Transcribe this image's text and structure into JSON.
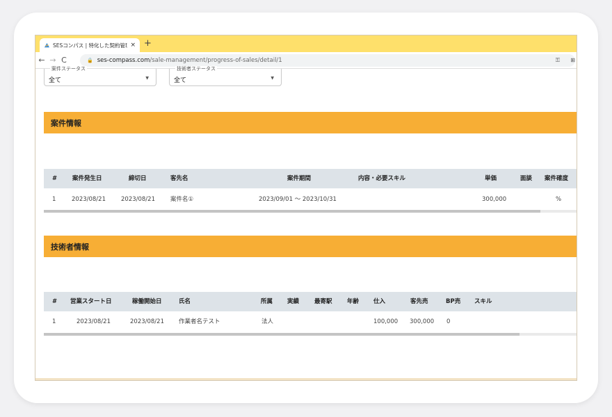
{
  "browser": {
    "tab_title": "SESコンパス | 特化した契約管理・…",
    "close_glyph": "×",
    "new_tab_glyph": "+",
    "url_host": "ses-compass.com",
    "url_path": "/sale-management/progress-of-sales/detail/1"
  },
  "filters": [
    {
      "label": "案件ステータス",
      "value": "全て"
    },
    {
      "label": "技術者ステータス",
      "value": "全て"
    }
  ],
  "projects": {
    "title": "案件情報",
    "headers": [
      "#",
      "案件発生日",
      "締切日",
      "客先名",
      "案件期間",
      "内容・必要スキル",
      "単価",
      "面談",
      "案件確度"
    ],
    "rows": [
      [
        "1",
        "2023/08/21",
        "2023/08/21",
        "案件名①",
        "2023/09/01 ～ 2023/10/31",
        "",
        "300,000",
        "",
        "%"
      ]
    ],
    "scroll_fraction": 0.93
  },
  "engineers": {
    "title": "技術者情報",
    "headers": [
      "#",
      "営業スタート日",
      "稼働開始日",
      "氏名",
      "所属",
      "実績",
      "最寄駅",
      "年齢",
      "仕入",
      "客先売",
      "BP売",
      "スキル"
    ],
    "rows": [
      [
        "1",
        "2023/08/21",
        "2023/08/21",
        "作業者名テスト",
        "法人",
        "",
        "",
        "",
        "100,000",
        "300,000",
        "0",
        ""
      ]
    ],
    "scroll_fraction": 0.89
  },
  "colors": {
    "accent": "#f7ae35",
    "tabbar": "#fee06b",
    "table_header": "#dde3e8"
  }
}
